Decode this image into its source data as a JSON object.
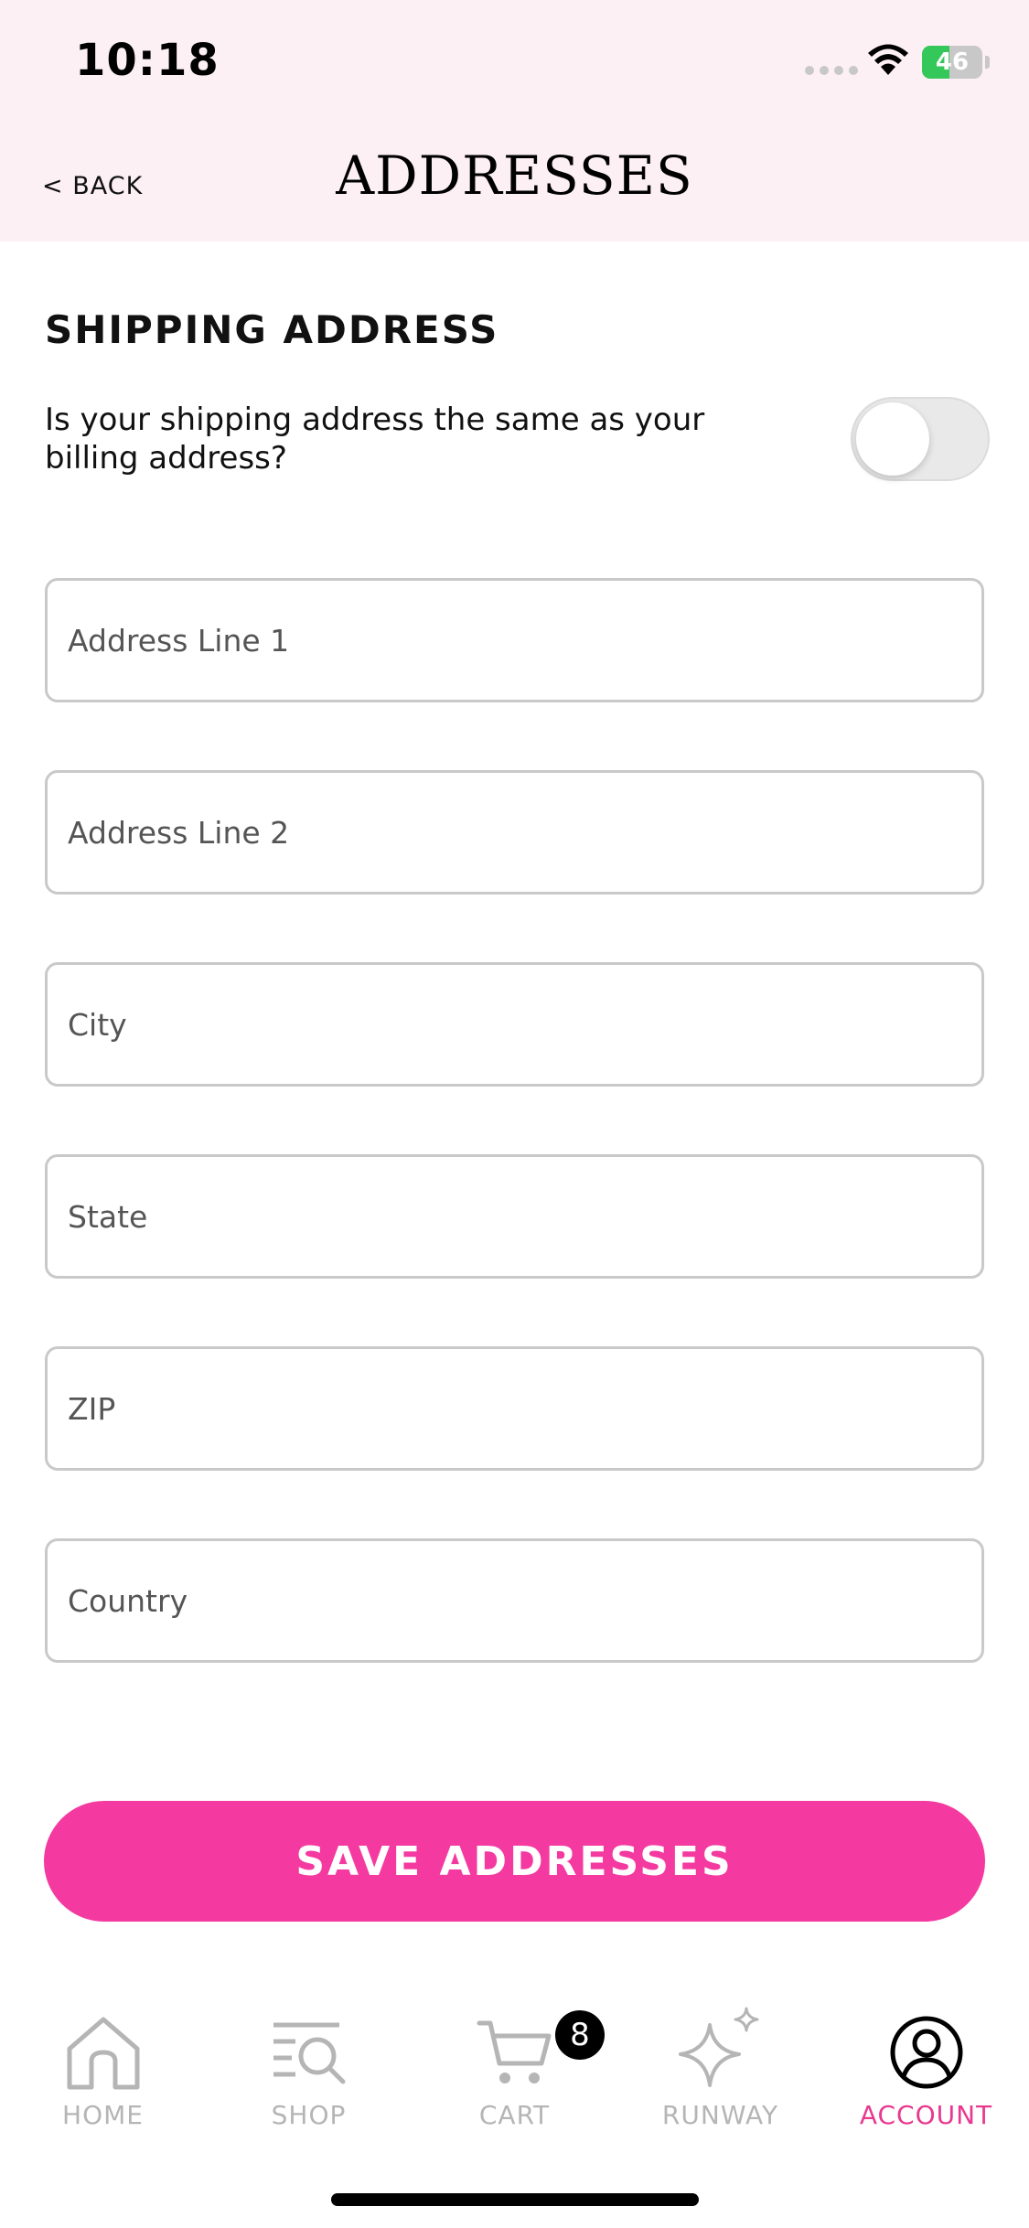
{
  "status_bar": {
    "time": "10:18",
    "battery_level": "46",
    "battery_fraction": 0.46,
    "icons": [
      "signal-dots-icon",
      "wifi-icon",
      "battery-charging-icon"
    ]
  },
  "header": {
    "back_label": "< BACK",
    "title": "ADDRESSES"
  },
  "form": {
    "section_title": "SHIPPING ADDRESS",
    "same_as_billing_question": "Is your shipping address the same as your billing address?",
    "same_as_billing_toggle_on": false,
    "fields": [
      {
        "name": "address-line-1",
        "placeholder": "Address Line 1",
        "value": ""
      },
      {
        "name": "address-line-2",
        "placeholder": "Address Line 2",
        "value": ""
      },
      {
        "name": "city",
        "placeholder": "City",
        "value": ""
      },
      {
        "name": "state",
        "placeholder": "State",
        "value": ""
      },
      {
        "name": "zip",
        "placeholder": "ZIP",
        "value": ""
      },
      {
        "name": "country",
        "placeholder": "Country",
        "value": ""
      }
    ],
    "save_label": "SAVE ADDRESSES"
  },
  "tabbar": {
    "items": [
      {
        "label": "HOME",
        "icon": "home-icon",
        "active": false
      },
      {
        "label": "SHOP",
        "icon": "shop-search-icon",
        "active": false
      },
      {
        "label": "CART",
        "icon": "cart-icon",
        "active": false,
        "badge": "8"
      },
      {
        "label": "RUNWAY",
        "icon": "sparkle-icon",
        "active": false
      },
      {
        "label": "ACCOUNT",
        "icon": "account-icon",
        "active": true
      }
    ]
  },
  "colors": {
    "accent": "#f43aa0",
    "active_tab": "#e8398f",
    "header_background": "#fdf0f5",
    "inactive_tab": "#b5b5b5"
  }
}
